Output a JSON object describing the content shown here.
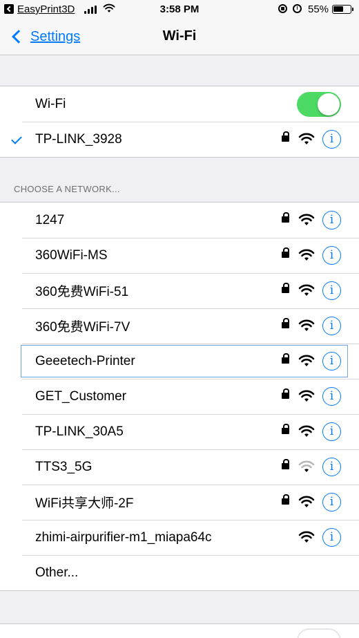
{
  "status_bar": {
    "app_back": "EasyPrint3D",
    "time": "3:58 PM",
    "battery": "55%"
  },
  "nav": {
    "back_label": "Settings",
    "title": "Wi-Fi"
  },
  "wifi_toggle": {
    "label": "Wi-Fi",
    "on": true
  },
  "connected": {
    "name": "TP-LINK_3928"
  },
  "section_header": "CHOOSE A NETWORK...",
  "networks": [
    {
      "name": "1247",
      "locked": true,
      "signal": "full"
    },
    {
      "name": "360WiFi-MS",
      "locked": true,
      "signal": "full"
    },
    {
      "name": "360免费WiFi-51",
      "locked": true,
      "signal": "full"
    },
    {
      "name": "360免费WiFi-7V",
      "locked": true,
      "signal": "full"
    },
    {
      "name": "Geeetech-Printer",
      "locked": true,
      "signal": "full",
      "highlighted": true
    },
    {
      "name": "GET_Customer",
      "locked": true,
      "signal": "full"
    },
    {
      "name": "TP-LINK_30A5",
      "locked": true,
      "signal": "full"
    },
    {
      "name": "TTS3_5G",
      "locked": true,
      "signal": "weak"
    },
    {
      "name": "WiFi共享大师-2F",
      "locked": true,
      "signal": "full"
    },
    {
      "name": "zhimi-airpurifier-m1_miapa64c",
      "locked": false,
      "signal": "full"
    }
  ],
  "other": "Other...",
  "icons": {
    "info": "i",
    "lock": "lock-icon",
    "wifi": "wifi-icon"
  },
  "colors": {
    "accent": "#007aff",
    "toggle_on": "#4cd964"
  }
}
